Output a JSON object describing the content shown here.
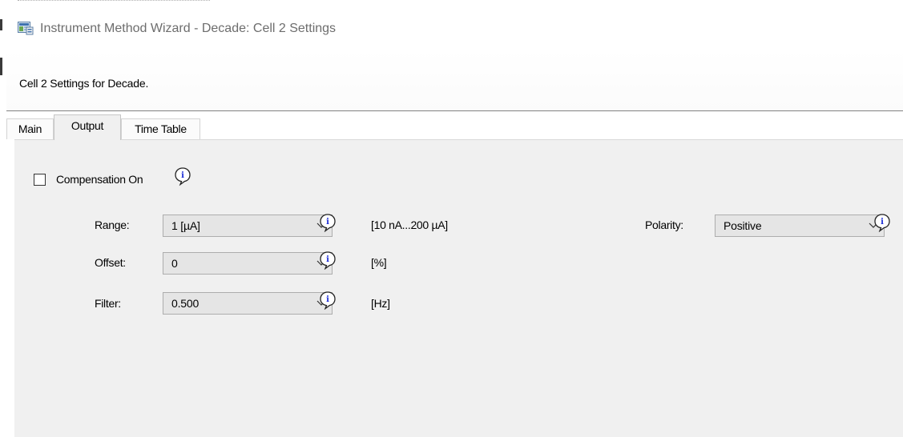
{
  "window": {
    "title": "Instrument Method Wizard - Decade: Cell 2 Settings",
    "app_icon": "wizard-window-icon"
  },
  "header": {
    "description": "Cell 2 Settings for Decade."
  },
  "tabs": [
    {
      "label": "Main",
      "active": false
    },
    {
      "label": "Output",
      "active": true
    },
    {
      "label": "Time Table",
      "active": false
    }
  ],
  "output": {
    "compensation": {
      "label": "Compensation On",
      "checked": false,
      "icon": "info-icon"
    },
    "range": {
      "label": "Range:",
      "value": "1 [µA]",
      "hint": "[10 nA...200 µA]"
    },
    "offset": {
      "label": "Offset:",
      "value": "0",
      "hint": "[%]"
    },
    "filter": {
      "label": "Filter:",
      "value": "0.500",
      "hint": "[Hz]"
    },
    "polarity": {
      "label": "Polarity:",
      "value": "Positive"
    }
  },
  "colors": {
    "content_bg": "#f0f0f0",
    "combo_bg": "#e5e5e5",
    "info_blue": "#1a2bd6",
    "title_gray": "#6d6d6d"
  }
}
